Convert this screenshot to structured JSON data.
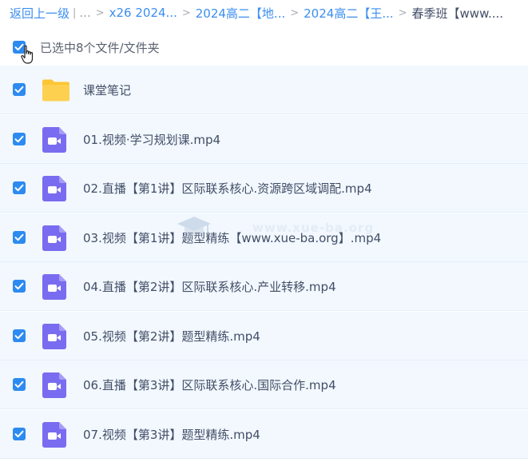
{
  "breadcrumb": {
    "back": "返回上一级",
    "ellipsis": "...",
    "crumbs": [
      "x26 2024...",
      "2024高二【地...",
      "2024高二【王..."
    ],
    "current": "春季班【www...."
  },
  "selection": {
    "status_text": "已选中8个文件/文件夹"
  },
  "watermark": "www.xue-ba.org",
  "files": [
    {
      "name": "课堂笔记",
      "type": "folder-icon"
    },
    {
      "name": "01.视频·学习规划课.mp4",
      "type": "video-file-icon"
    },
    {
      "name": "02.直播【第1讲】区际联系核心.资源跨区域调配.mp4",
      "type": "video-file-icon"
    },
    {
      "name": "03.视频【第1讲】题型精练【www.xue-ba.org】.mp4",
      "type": "video-file-icon"
    },
    {
      "name": "04.直播【第2讲】区际联系核心.产业转移.mp4",
      "type": "video-file-icon"
    },
    {
      "name": "05.视频【第2讲】题型精练.mp4",
      "type": "video-file-icon"
    },
    {
      "name": "06.直播【第3讲】区际联系核心.国际合作.mp4",
      "type": "video-file-icon"
    },
    {
      "name": "07.视频【第3讲】题型精练.mp4",
      "type": "video-file-icon"
    }
  ],
  "colors": {
    "link": "#3b8ef0",
    "checkbox": "#2d8bf0",
    "row_background": "#f2f8fe",
    "video_icon": "#7a6cf0",
    "folder_icon": "#fcc534"
  }
}
